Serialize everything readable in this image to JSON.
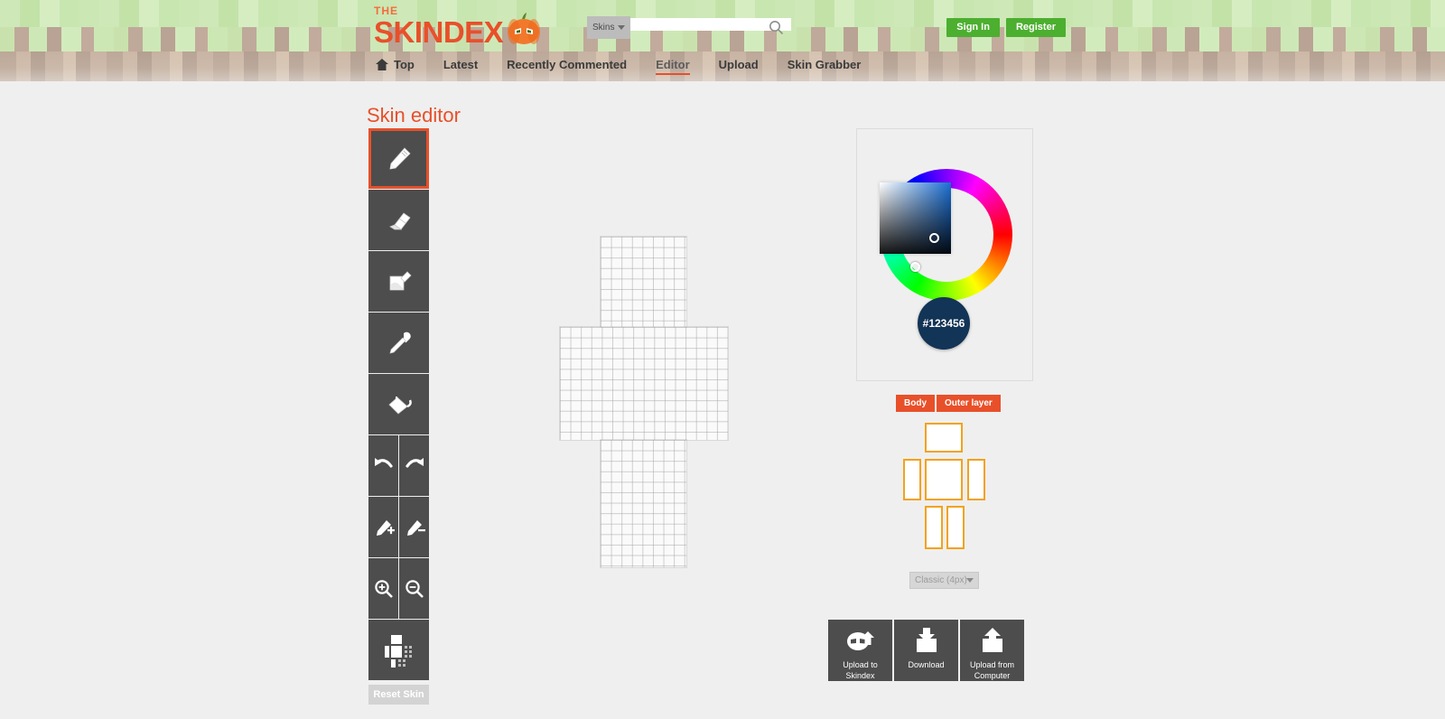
{
  "header": {
    "logo": {
      "the": "THE",
      "name": "SKINDEX",
      "pumpkin_icon": "pumpkin-icon"
    },
    "search": {
      "category": "Skins",
      "value": "",
      "placeholder": "",
      "icon": "search-icon"
    },
    "auth": {
      "sign_in": "Sign In",
      "register": "Register"
    },
    "nav": [
      {
        "label": "Top",
        "icon": "home-icon",
        "active": false
      },
      {
        "label": "Latest",
        "active": false
      },
      {
        "label": "Recently Commented",
        "active": false
      },
      {
        "label": "Editor",
        "active": true
      },
      {
        "label": "Upload",
        "active": false
      },
      {
        "label": "Skin Grabber",
        "active": false
      }
    ]
  },
  "page": {
    "title": "Skin editor"
  },
  "toolbar": {
    "tools": [
      {
        "name": "pencil-tool",
        "icon": "pencil-icon",
        "selected": true
      },
      {
        "name": "eraser-tool",
        "icon": "eraser-icon",
        "selected": false
      },
      {
        "name": "brush-tool",
        "icon": "brush-icon",
        "selected": false
      },
      {
        "name": "eyedropper-tool",
        "icon": "eyedropper-icon",
        "selected": false
      },
      {
        "name": "bucket-fill-tool",
        "icon": "paint-bucket-icon",
        "selected": false
      },
      {
        "name": "undo-tool",
        "icon": "undo-arrow-icon",
        "selected": false
      },
      {
        "name": "redo-tool",
        "icon": "redo-arrow-icon",
        "selected": false
      },
      {
        "name": "noise-add-tool",
        "icon": "brush-plus-icon",
        "selected": false
      },
      {
        "name": "noise-remove-tool",
        "icon": "brush-minus-icon",
        "selected": false
      },
      {
        "name": "zoom-in-tool",
        "icon": "magnifier-plus-icon",
        "selected": false
      },
      {
        "name": "zoom-out-tool",
        "icon": "magnifier-minus-icon",
        "selected": false
      },
      {
        "name": "layout-tool",
        "icon": "skin-layout-icon",
        "selected": false
      }
    ],
    "reset_label": "Reset Skin"
  },
  "color_picker": {
    "hex": "#123456",
    "wheel_icon": "color-wheel",
    "sv_square_icon": "saturation-value-square"
  },
  "layers": {
    "body": "Body",
    "outer": "Outer layer"
  },
  "body_parts": [
    {
      "name": "head",
      "label": "Head"
    },
    {
      "name": "arm-left",
      "label": "Left Arm"
    },
    {
      "name": "torso",
      "label": "Torso"
    },
    {
      "name": "arm-right",
      "label": "Right Arm"
    },
    {
      "name": "leg-left",
      "label": "Left Leg"
    },
    {
      "name": "leg-right",
      "label": "Right Leg"
    }
  ],
  "model": {
    "selected": "Classic (4px)"
  },
  "actions": [
    {
      "name": "upload-to-skindex",
      "icon": "pumpkin-upload-icon",
      "line1": "Upload to",
      "line2": "Skindex"
    },
    {
      "name": "download",
      "icon": "download-icon",
      "line1": "Download",
      "line2": ""
    },
    {
      "name": "upload-from-computer",
      "icon": "upload-icon",
      "line1": "Upload from",
      "line2": "Computer"
    }
  ],
  "colors": {
    "brand_orange": "#e8502a",
    "nav_active_underline": "#e8502a",
    "green_button": "#4caf2f",
    "tool_bg": "#4d4d4d",
    "bodypart_outline": "#f2a21c",
    "selected_color": "#123456"
  }
}
